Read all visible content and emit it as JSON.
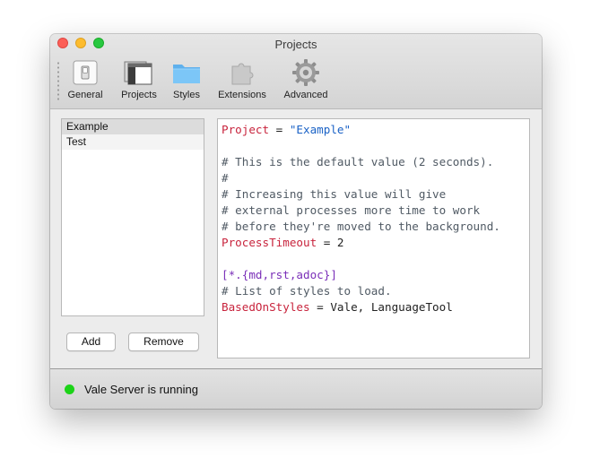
{
  "window": {
    "title": "Projects"
  },
  "toolbar": {
    "items": [
      {
        "label": "General",
        "icon": "general-switch-icon"
      },
      {
        "label": "Projects",
        "icon": "projects-windows-icon"
      },
      {
        "label": "Styles",
        "icon": "folder-icon"
      },
      {
        "label": "Extensions",
        "icon": "puzzle-piece-icon"
      },
      {
        "label": "Advanced",
        "icon": "gear-icon"
      }
    ]
  },
  "projects": {
    "items": [
      "Example",
      "Test"
    ],
    "selected": "Example",
    "add_label": "Add",
    "remove_label": "Remove"
  },
  "editor": {
    "lines": [
      {
        "key": "Project",
        "op": " = ",
        "value": "\"Example\""
      },
      {
        "text": ""
      },
      {
        "comment": "# This is the default value (2 seconds)."
      },
      {
        "comment": "#"
      },
      {
        "comment": "# Increasing this value will give"
      },
      {
        "comment": "# external processes more time to work"
      },
      {
        "comment": "# before they're moved to the background."
      },
      {
        "key": "ProcessTimeout",
        "op": " = ",
        "plain": "2"
      },
      {
        "text": ""
      },
      {
        "section": "[*.{md,rst,adoc}]"
      },
      {
        "comment": "# List of styles to load."
      },
      {
        "key": "BasedOnStyles",
        "op": " = ",
        "plain": "Vale, LanguageTool"
      }
    ]
  },
  "status": {
    "text": "Vale Server is running",
    "color": "#1cd318"
  },
  "colors": {
    "key": "#c8243d",
    "string": "#1a62c6",
    "section": "#7a2fb8",
    "comment": "#505a64"
  }
}
